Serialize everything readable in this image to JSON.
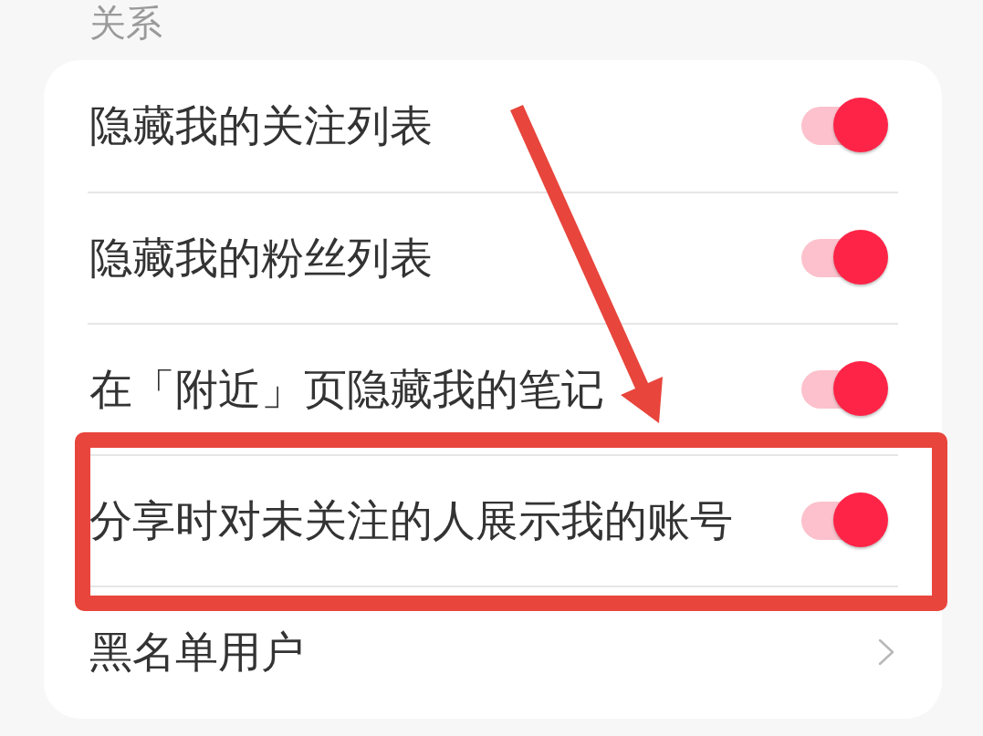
{
  "section": {
    "title": "关系"
  },
  "rows": [
    {
      "kind": "toggle",
      "label": "隐藏我的关注列表",
      "on": true,
      "highlighted": false
    },
    {
      "kind": "toggle",
      "label": "隐藏我的粉丝列表",
      "on": true,
      "highlighted": false
    },
    {
      "kind": "toggle",
      "label": "在「附近」页隐藏我的笔记",
      "on": true,
      "highlighted": false
    },
    {
      "kind": "toggle",
      "label": "分享时对未关注的人展示我的账号",
      "on": true,
      "highlighted": true
    },
    {
      "kind": "link",
      "label": "黑名单用户",
      "highlighted": false
    }
  ],
  "annotations": [
    {
      "kind": "arrow"
    }
  ]
}
